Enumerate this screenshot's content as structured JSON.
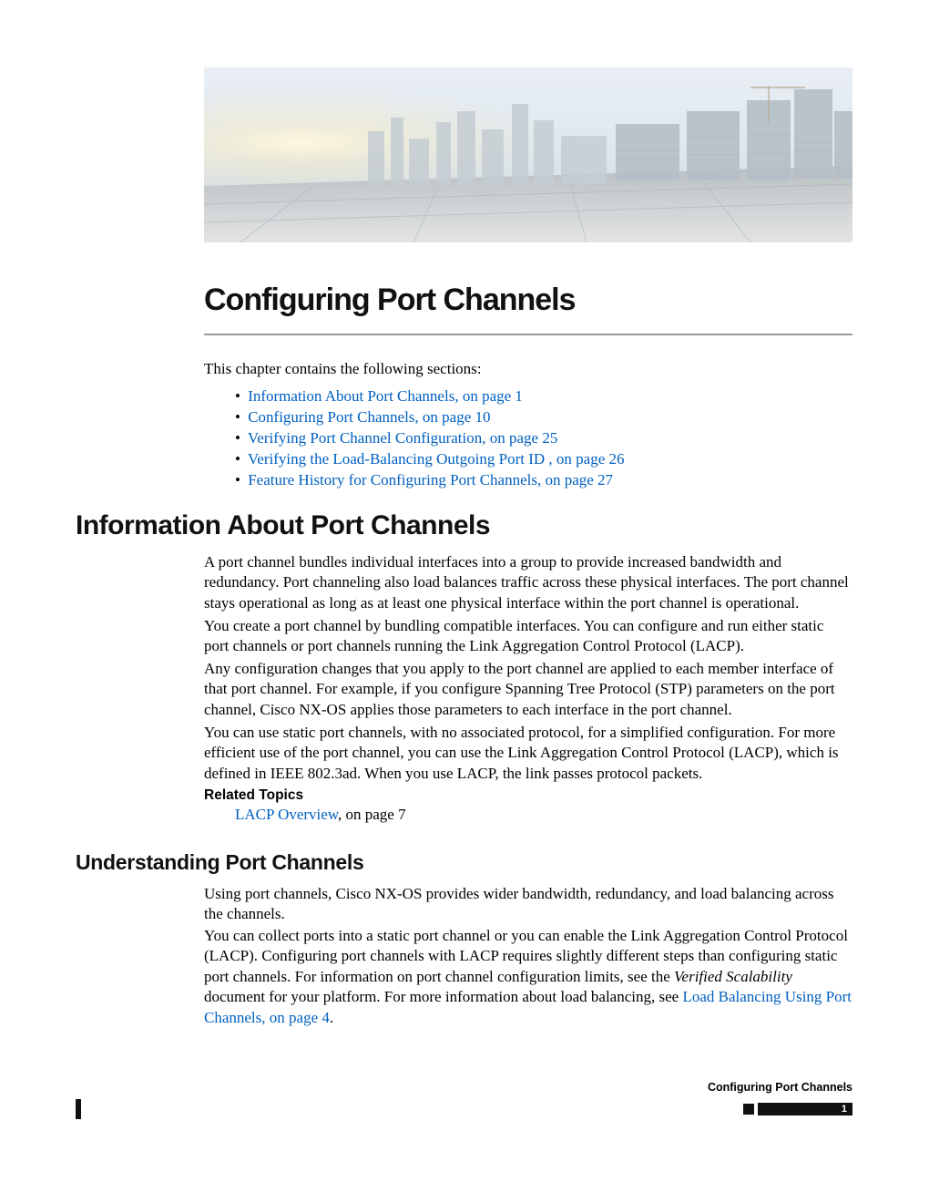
{
  "chapter": {
    "title": "Configuring Port Channels"
  },
  "intro": "This chapter contains the following sections:",
  "toc": [
    {
      "label": "Information About Port Channels, on page 1"
    },
    {
      "label": "Configuring Port Channels, on page 10"
    },
    {
      "label": "Verifying Port Channel Configuration, on page 25"
    },
    {
      "label": "Verifying the Load-Balancing Outgoing Port ID , on page 26"
    },
    {
      "label": "Feature History for Configuring Port Channels, on page 27"
    }
  ],
  "section1": {
    "heading": "Information About Port Channels",
    "p1": "A port channel bundles individual interfaces into a group to provide increased bandwidth and redundancy. Port channeling also load balances traffic across these physical interfaces. The port channel stays operational as long as at least one physical interface within the port channel is operational.",
    "p2": "You create a port channel by bundling compatible interfaces. You can configure and run either static port channels or port channels running the Link Aggregation Control Protocol (LACP).",
    "p3": "Any configuration changes that you apply to the port channel are applied to each member interface of that port channel. For example, if you configure Spanning Tree Protocol (STP) parameters on the port channel, Cisco NX-OS applies those parameters to each interface in the port channel.",
    "p4": "You can use static port channels, with no associated protocol, for a simplified configuration. For more efficient use of the port channel, you can use the Link Aggregation Control Protocol (LACP), which is defined in IEEE 802.3ad. When you use LACP, the link passes protocol packets.",
    "related_heading": "Related Topics",
    "related_link": "LACP Overview",
    "related_tail": ", on page 7"
  },
  "section2": {
    "heading": "Understanding Port Channels",
    "p1": "Using port channels, Cisco NX-OS provides wider bandwidth, redundancy, and load balancing across the channels.",
    "p2a": "You can collect ports into a static port channel or you can enable the Link Aggregation Control Protocol (LACP). Configuring port channels with LACP requires slightly different steps than configuring static port channels. For information on port channel configuration limits, see the ",
    "p2_ital": "Verified Scalability",
    "p2b": " document for your platform. For more information about load balancing, see ",
    "p2_link": "Load Balancing Using Port Channels, on page 4",
    "p2c": "."
  },
  "footer": {
    "book": "Configuring Port Channels",
    "page": "1"
  }
}
